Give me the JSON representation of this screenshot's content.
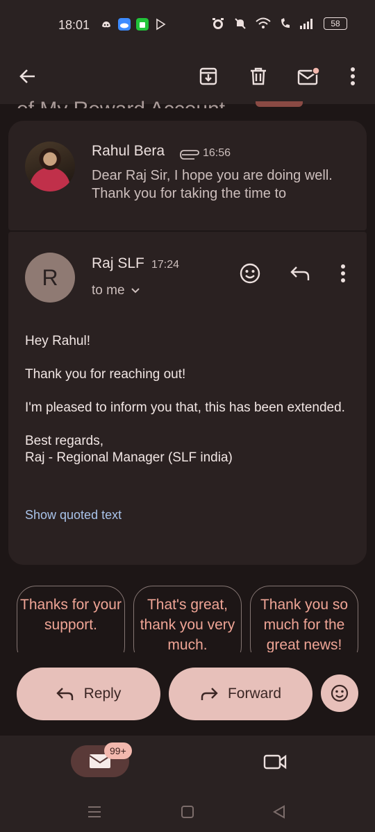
{
  "status_bar": {
    "time": "18:01",
    "battery": "58"
  },
  "toolbar": {
    "back_icon": "arrow-left-icon",
    "archive_icon": "archive-icon",
    "delete_icon": "trash-icon",
    "unread_icon": "mark-unread-icon",
    "more_icon": "more-vert-icon"
  },
  "subject_peek": "of My Reward Account",
  "collapsed_message": {
    "sender": "Rahul Bera",
    "time": "16:56",
    "snippet": "Dear Raj Sir, I hope you are doing well. Thank you for taking the time to"
  },
  "expanded_message": {
    "avatar_letter": "R",
    "sender": "Raj SLF",
    "time": "17:24",
    "recipient": "to me",
    "body": [
      "Hey Rahul!",
      "Thank you for reaching out!",
      "I'm pleased to inform you that, this has been extended.",
      "Best regards,\nRaj - Regional Manager (SLF india)"
    ],
    "show_quoted": "Show quoted text"
  },
  "smart_replies": [
    "Thanks for your support.",
    "That's great, thank you very much.",
    "Thank you so much for the great news!"
  ],
  "actions": {
    "reply": "Reply",
    "forward": "Forward"
  },
  "bottom_nav": {
    "mail_badge": "99+"
  },
  "colors": {
    "accent": "#e7c0ba",
    "chip_text": "#f0a596",
    "link": "#a9c3ea",
    "background": "#1d1616",
    "card": "#2a2121"
  }
}
